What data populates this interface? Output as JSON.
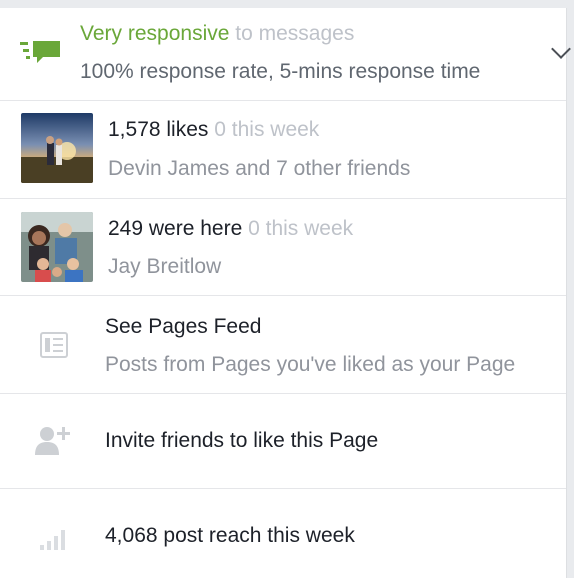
{
  "responsiveness": {
    "headline_highlight": "Very responsive",
    "headline_rest": "to messages",
    "detail": "100% response rate, 5-mins response time",
    "icon": "message-bubble-icon"
  },
  "likes": {
    "count_text": "1,578 likes",
    "week_text": "0 this week",
    "friends_text": "Devin James and 7 other friends"
  },
  "checkins": {
    "count_text": "249 were here",
    "week_text": "0 this week",
    "friend_text": "Jay Breitlow"
  },
  "pages_feed": {
    "title": "See Pages Feed",
    "subtitle": "Posts from Pages you've liked as your Page",
    "icon": "feed-icon"
  },
  "invite": {
    "label": "Invite friends to like this Page",
    "icon": "add-friend-icon"
  },
  "reach": {
    "label": "4,068 post reach this week",
    "icon": "bar-chart-icon"
  },
  "colors": {
    "accent_green": "#6aa739",
    "text_primary": "#1d2129",
    "text_secondary": "#90949c",
    "text_muted": "#bec2c9"
  }
}
